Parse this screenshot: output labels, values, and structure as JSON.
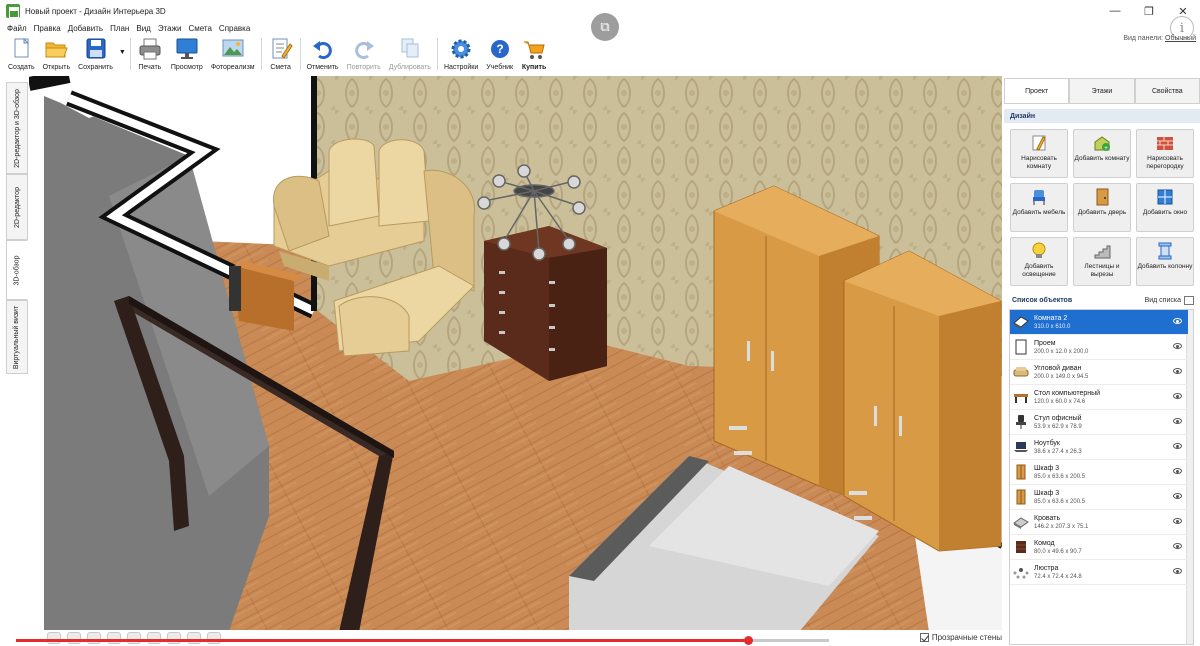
{
  "window": {
    "title": "Новый проект - Дизайн Интерьера 3D",
    "controls": [
      "—",
      "❐",
      "✕"
    ]
  },
  "menu": [
    "Файл",
    "Правка",
    "Добавить",
    "План",
    "Вид",
    "Этажи",
    "Смета",
    "Справка"
  ],
  "toolbar": {
    "items": [
      {
        "label": "Создать",
        "icon": "new-file-icon"
      },
      {
        "label": "Открыть",
        "icon": "open-folder-icon"
      },
      {
        "label": "Сохранить",
        "icon": "floppy-disk-icon"
      },
      {
        "label": "Печать",
        "icon": "printer-icon"
      },
      {
        "label": "Просмотр",
        "icon": "monitor-icon"
      },
      {
        "label": "Фотореализм",
        "icon": "photo-icon"
      },
      {
        "label": "Смета",
        "icon": "estimate-icon"
      },
      {
        "label": "Отменить",
        "icon": "undo-icon"
      },
      {
        "label": "Повторить",
        "icon": "redo-icon",
        "disabled": true
      },
      {
        "label": "Дублировать",
        "icon": "duplicate-icon",
        "disabled": true
      },
      {
        "label": "Настройки",
        "icon": "gear-icon"
      },
      {
        "label": "Учебник",
        "icon": "help-icon"
      },
      {
        "label": "Купить",
        "icon": "cart-icon",
        "bold": true
      }
    ],
    "panel_view_label": "Вид панели:",
    "panel_view_value": "Обычный"
  },
  "left_tabs": [
    {
      "label": "2D-редактор и 3D-обзор"
    },
    {
      "label": "2D-редактор"
    },
    {
      "label": "3D-обзор",
      "active": true
    },
    {
      "label": "Виртуальный визит"
    }
  ],
  "right_panel": {
    "tabs": [
      {
        "label": "Проект",
        "active": true
      },
      {
        "label": "Этажи"
      },
      {
        "label": "Свойства"
      }
    ],
    "design_title": "Дизайн",
    "design_buttons": [
      {
        "label": "Нарисовать комнату",
        "icon": "pencil-icon"
      },
      {
        "label": "Добавить комнату",
        "icon": "add-room-icon"
      },
      {
        "label": "Нарисовать перегородку",
        "icon": "brick-wall-icon"
      },
      {
        "label": "Добавить мебель",
        "icon": "chair-icon"
      },
      {
        "label": "Добавить дверь",
        "icon": "door-icon"
      },
      {
        "label": "Добавить окно",
        "icon": "window-icon"
      },
      {
        "label": "Добавить освещение",
        "icon": "light-bulb-icon"
      },
      {
        "label": "Лестницы и вырезы",
        "icon": "stairs-icon"
      },
      {
        "label": "Добавить колонну",
        "icon": "column-icon"
      }
    ],
    "objects_title": "Список объектов",
    "objects_view_label": "Вид списка",
    "objects": [
      {
        "name": "Комната 2",
        "dims": "310.0 x 610.0",
        "icon": "room-icon",
        "selected": true
      },
      {
        "name": "Проем",
        "dims": "200.0 x 12.0 x 200.0",
        "icon": "opening-icon"
      },
      {
        "name": "Угловой диван",
        "dims": "200.0 x 149.0 x 94.5",
        "icon": "sofa-icon"
      },
      {
        "name": "Стол компьютерный",
        "dims": "120.0 x 60.0 x 74.6",
        "icon": "desk-icon"
      },
      {
        "name": "Стул офисный",
        "dims": "53.9 x 62.9 x 78.9",
        "icon": "office-chair-icon"
      },
      {
        "name": "Ноутбук",
        "dims": "38.6 x 27.4 x 26.3",
        "icon": "laptop-icon"
      },
      {
        "name": "Шкаф 3",
        "dims": "85.0 x 63.6 x 200.5",
        "icon": "wardrobe-icon"
      },
      {
        "name": "Шкаф 3",
        "dims": "85.0 x 63.6 x 200.5",
        "icon": "wardrobe-icon"
      },
      {
        "name": "Кровать",
        "dims": "146.2 x 207.3 x 75.1",
        "icon": "bed-icon"
      },
      {
        "name": "Комод",
        "dims": "80.0 x 49.6 x 90.7",
        "icon": "dresser-icon"
      },
      {
        "name": "Люстра",
        "dims": "72.4 x 72.4 x 24.8",
        "icon": "chandelier-icon"
      }
    ]
  },
  "bottom": {
    "transparent_walls_label": "Прозрачные стены",
    "transparent_walls_checked": true,
    "video_progress": 0.9
  },
  "colors": {
    "accent": "#1f6fd0",
    "progress": "#e52b2b",
    "floor": "#c98a55",
    "wallpaper": "#cbbf9a",
    "wardrobe": "#d99a45",
    "dresser": "#5a2a1a",
    "sofa": "#e6cc95"
  }
}
